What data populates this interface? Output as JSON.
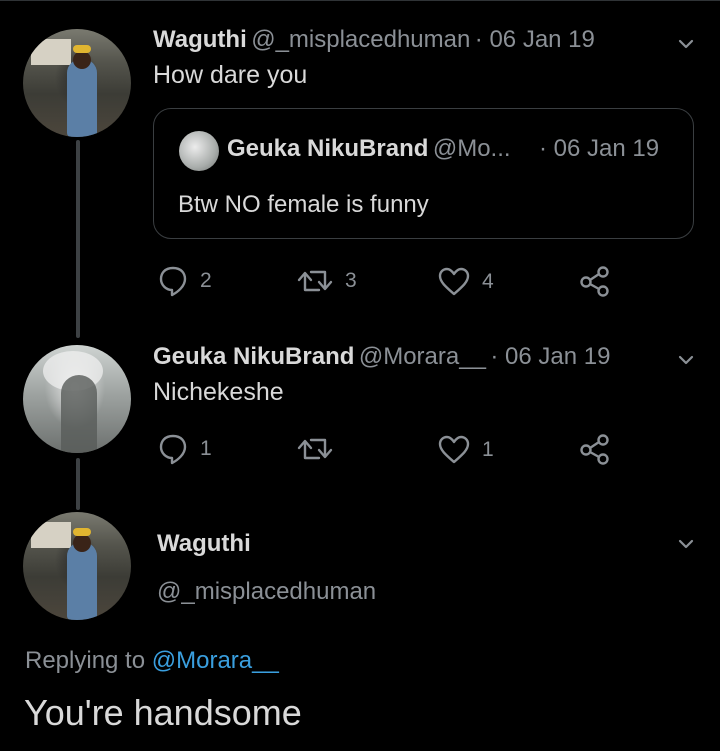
{
  "tweets": [
    {
      "display_name": "Waguthi",
      "handle": "@_misplacedhuman",
      "date": "· 06 Jan 19",
      "text": "How dare you",
      "avatar_icon": "profile-photo-woman",
      "quoted": {
        "display_name": "Geuka NikuBrand",
        "handle": "@Mo...",
        "date": "· 06 Jan 19",
        "text": "Btw NO female is funny"
      },
      "actions": {
        "replies": "2",
        "retweets": "3",
        "likes": "4"
      }
    },
    {
      "display_name": "Geuka NikuBrand",
      "handle": "@Morara__",
      "date": "· 06 Jan 19",
      "text": "Nichekeshe",
      "avatar_icon": "profile-photo-man",
      "actions": {
        "replies": "1",
        "retweets": "",
        "likes": "1"
      }
    }
  ],
  "main_tweet": {
    "display_name": "Waguthi",
    "handle": "@_misplacedhuman",
    "replying_prefix": "Replying to",
    "replying_to": "@Morara__",
    "text": "You're handsome"
  },
  "icons": [
    "reply-icon",
    "retweet-icon",
    "like-icon",
    "share-icon",
    "chevron-down-icon"
  ],
  "colors": {
    "background": "#000000",
    "text": "#d9d9d9",
    "muted": "#8b9096",
    "link": "#3a9fdf",
    "thread_line": "#3d4144"
  }
}
